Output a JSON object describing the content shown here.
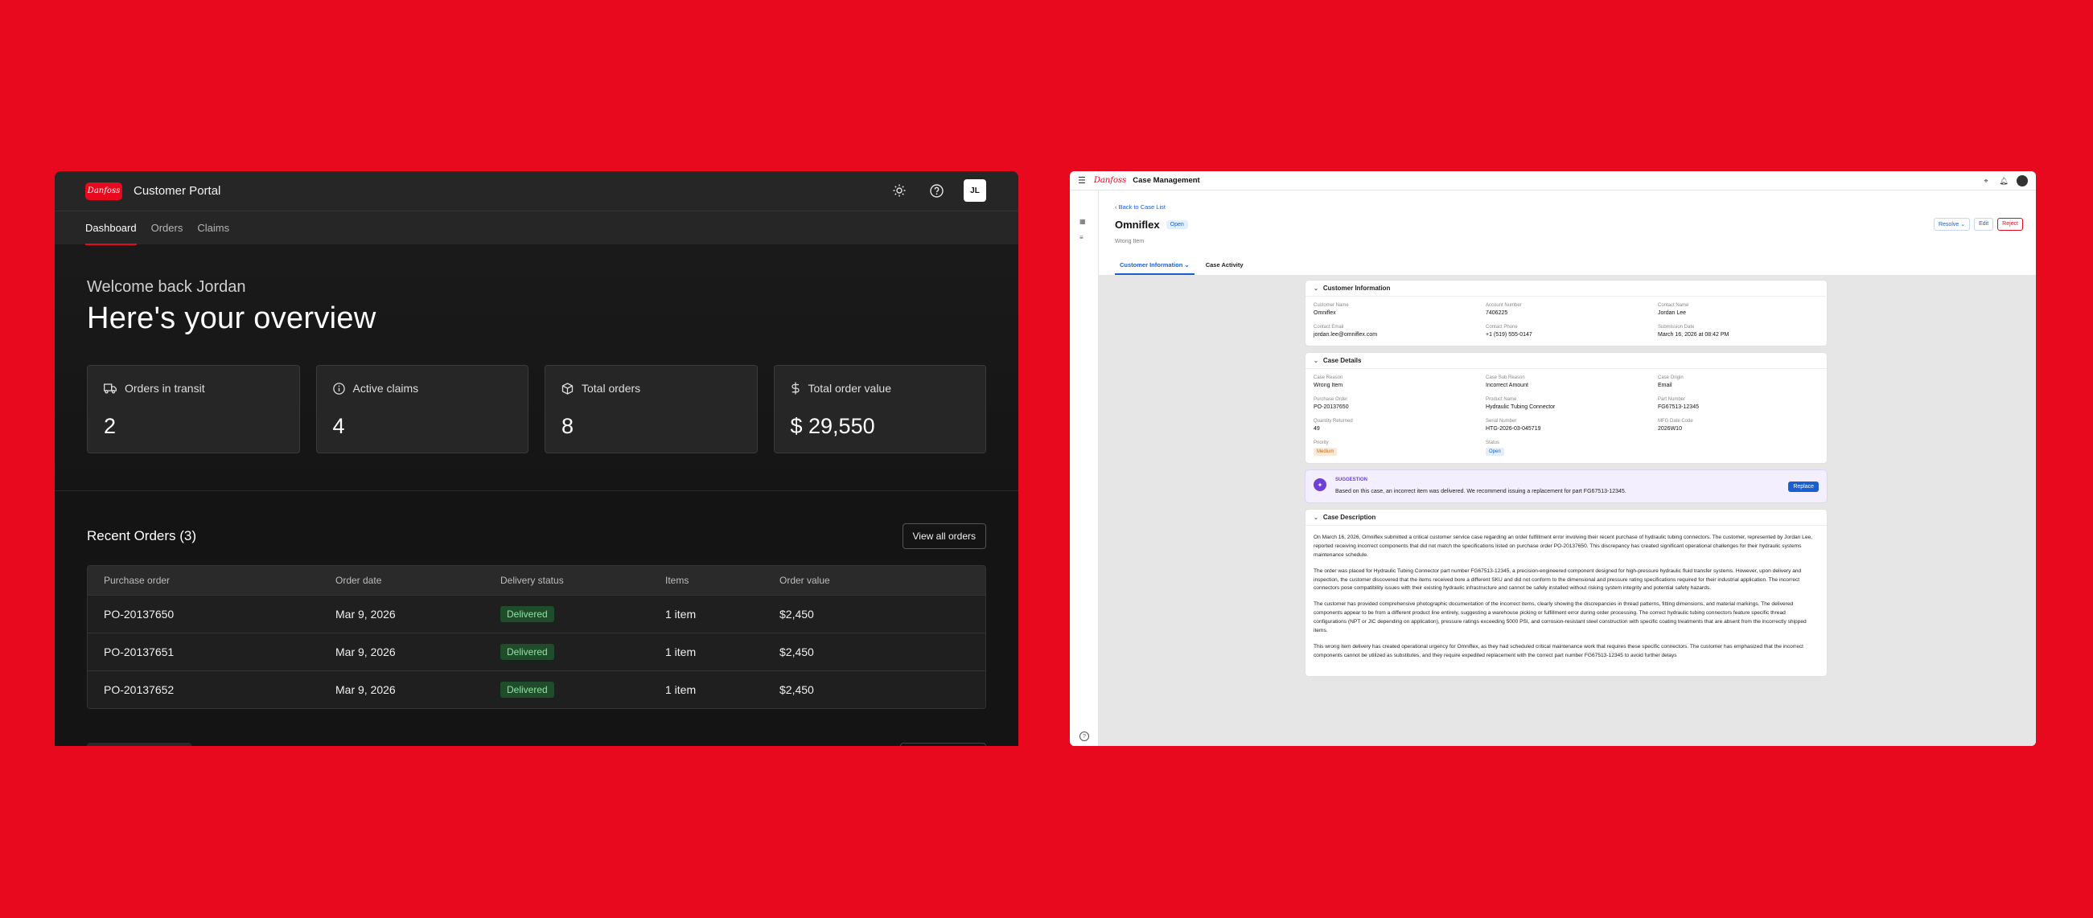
{
  "portal": {
    "title": "Customer Portal",
    "logo_text": "Danfoss",
    "avatar": "JL",
    "nav": [
      "Dashboard",
      "Orders",
      "Claims"
    ],
    "welcome": "Welcome back Jordan",
    "overview": "Here's your overview",
    "stats": [
      {
        "label": "Orders in transit",
        "value": "2",
        "icon": "truck-icon"
      },
      {
        "label": "Active claims",
        "value": "4",
        "icon": "info-icon"
      },
      {
        "label": "Total orders",
        "value": "8",
        "icon": "box-icon"
      },
      {
        "label": "Total order value",
        "value": "$ 29,550",
        "icon": "dollar-icon"
      }
    ],
    "recent_orders_title": "Recent Orders (3)",
    "view_all": "View all orders",
    "columns": [
      "Purchase order",
      "Order date",
      "Delivery status",
      "Items",
      "Order value"
    ],
    "rows": [
      [
        "PO-20137650",
        "Mar 9, 2026",
        "Delivered",
        "1 item",
        "$2,450"
      ],
      [
        "PO-20137651",
        "Mar 9, 2026",
        "Delivered",
        "1 item",
        "$2,450"
      ],
      [
        "PO-20137652",
        "Mar 9, 2026",
        "Delivered",
        "1 item",
        "$2,450"
      ]
    ]
  },
  "cm": {
    "title": "Case Management",
    "logo_text": "Danfoss",
    "back": "Back to Case List",
    "case_name": "Omniflex",
    "status": "Open",
    "subtitle": "Wrong Item",
    "actions": {
      "resolve": "Resolve",
      "edit": "Edit",
      "reject": "Reject"
    },
    "tabs": [
      "Customer Information",
      "Case Activity"
    ],
    "customer_info": {
      "title": "Customer Information",
      "fields": [
        {
          "label": "Customer Name",
          "value": "Omniflex"
        },
        {
          "label": "Account Number",
          "value": "7406225"
        },
        {
          "label": "Contact Name",
          "value": "Jordan Lee"
        },
        {
          "label": "Contact Email",
          "value": "jordan.lee@omniflex.com"
        },
        {
          "label": "Contact Phone",
          "value": "+1 (519) 555-0147"
        },
        {
          "label": "Submission Date",
          "value": "March 16, 2026 at 08:42 PM"
        }
      ]
    },
    "case_details": {
      "title": "Case Details",
      "fields": [
        {
          "label": "Case Reason",
          "value": "Wrong Item"
        },
        {
          "label": "Case Sub Reason",
          "value": "Incorrect Amount"
        },
        {
          "label": "Case Origin",
          "value": "Email"
        },
        {
          "label": "Purchase Order",
          "value": "PO-20137650"
        },
        {
          "label": "Product Name",
          "value": "Hydraulic Tubing Connector"
        },
        {
          "label": "Part Number",
          "value": "FG67513-12345"
        },
        {
          "label": "Quantity Returned",
          "value": "49"
        },
        {
          "label": "Serial Number",
          "value": "HTG-2026-03-045719"
        },
        {
          "label": "MFG Date Code",
          "value": "2026W10"
        }
      ],
      "priority_label": "Priority",
      "priority_value": "Medium",
      "status_label": "Status",
      "status_value": "Open"
    },
    "suggestion": {
      "title": "SUGGESTION",
      "body": "Based on this case, an incorrect item was delivered. We recommend issuing a replacement for part FG67513-12345.",
      "button": "Replace"
    },
    "description": {
      "title": "Case Description",
      "paragraphs": [
        "On March 16, 2026, Omniflex submitted a critical customer service case regarding an order fulfillment error involving their recent purchase of hydraulic tubing connectors. The customer, represented by Jordan Lee, reported receiving incorrect components that did not match the specifications listed on purchase order PO-20137650. This discrepancy has created significant operational challenges for their hydraulic systems maintenance schedule.",
        "The order was placed for Hydraulic Tubing Connector part number FG67513-12345, a precision-engineered component designed for high-pressure hydraulic fluid transfer systems. However, upon delivery and inspection, the customer discovered that the items received bore a different SKU and did not conform to the dimensional and pressure rating specifications required for their industrial application. The incorrect connectors pose compatibility issues with their existing hydraulic infrastructure and cannot be safely installed without risking system integrity and potential safety hazards.",
        "The customer has provided comprehensive photographic documentation of the incorrect items, clearly showing the discrepancies in thread patterns, fitting dimensions, and material markings. The delivered components appear to be from a different product line entirely, suggesting a warehouse picking or fulfillment error during order processing. The correct hydraulic tubing connectors feature specific thread configurations (NPT or JIC depending on application), pressure ratings exceeding 5000 PSI, and corrosion-resistant steel construction with specific coating treatments that are absent from the incorrectly shipped items.",
        "This wrong item delivery has created operational urgency for Omniflex, as they had scheduled critical maintenance work that requires these specific connectors. The customer has emphasized that the incorrect components cannot be utilized as substitutes, and they require expedited replacement with the correct part number FG67513-12345 to avoid further delays"
      ]
    }
  }
}
